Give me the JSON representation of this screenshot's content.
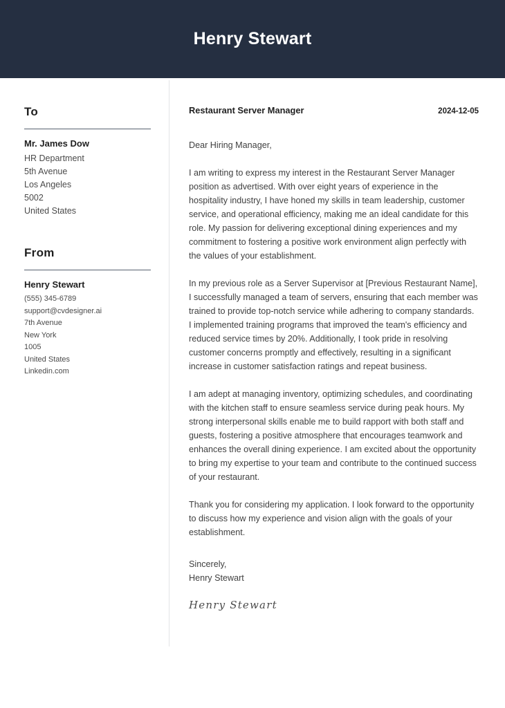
{
  "header": {
    "name": "Henry Stewart"
  },
  "sidebar": {
    "to": {
      "heading": "To",
      "name": "Mr. James Dow",
      "lines": [
        "HR Department",
        "5th Avenue",
        "Los Angeles",
        "5002",
        "United States"
      ]
    },
    "from": {
      "heading": "From",
      "name": "Henry Stewart",
      "lines": [
        "(555) 345-6789",
        "support@cvdesigner.ai",
        "7th Avenue",
        "New York",
        "1005",
        "United States",
        "Linkedin.com"
      ]
    }
  },
  "letter": {
    "job_title": "Restaurant Server Manager",
    "date": "2024-12-05",
    "salutation": "Dear Hiring Manager,",
    "paragraphs": [
      "I am writing to express my interest in the Restaurant Server Manager position as advertised. With over eight years of experience in the hospitality industry, I have honed my skills in team leadership, customer service, and operational efficiency, making me an ideal candidate for this role. My passion for delivering exceptional dining experiences and my commitment to fostering a positive work environment align perfectly with the values of your establishment.",
      "In my previous role as a Server Supervisor at [Previous Restaurant Name], I successfully managed a team of servers, ensuring that each member was trained to provide top-notch service while adhering to company standards. I implemented training programs that improved the team's efficiency and reduced service times by 20%. Additionally, I took pride in resolving customer concerns promptly and effectively, resulting in a significant increase in customer satisfaction ratings and repeat business.",
      "I am adept at managing inventory, optimizing schedules, and coordinating with the kitchen staff to ensure seamless service during peak hours. My strong interpersonal skills enable me to build rapport with both staff and guests, fostering a positive atmosphere that encourages teamwork and enhances the overall dining experience. I am excited about the opportunity to bring my expertise to your team and contribute to the continued success of your restaurant.",
      "Thank you for considering my application. I look forward to the opportunity to discuss how my experience and vision align with the goals of your establishment."
    ],
    "closing_word": "Sincerely,",
    "closing_name": "Henry Stewart",
    "signature": "Henry Stewart"
  },
  "colors": {
    "header_background": "#252f41",
    "header_text": "#ffffff",
    "body_text": "#3f3f3f",
    "divider": "#e3e4e6"
  }
}
